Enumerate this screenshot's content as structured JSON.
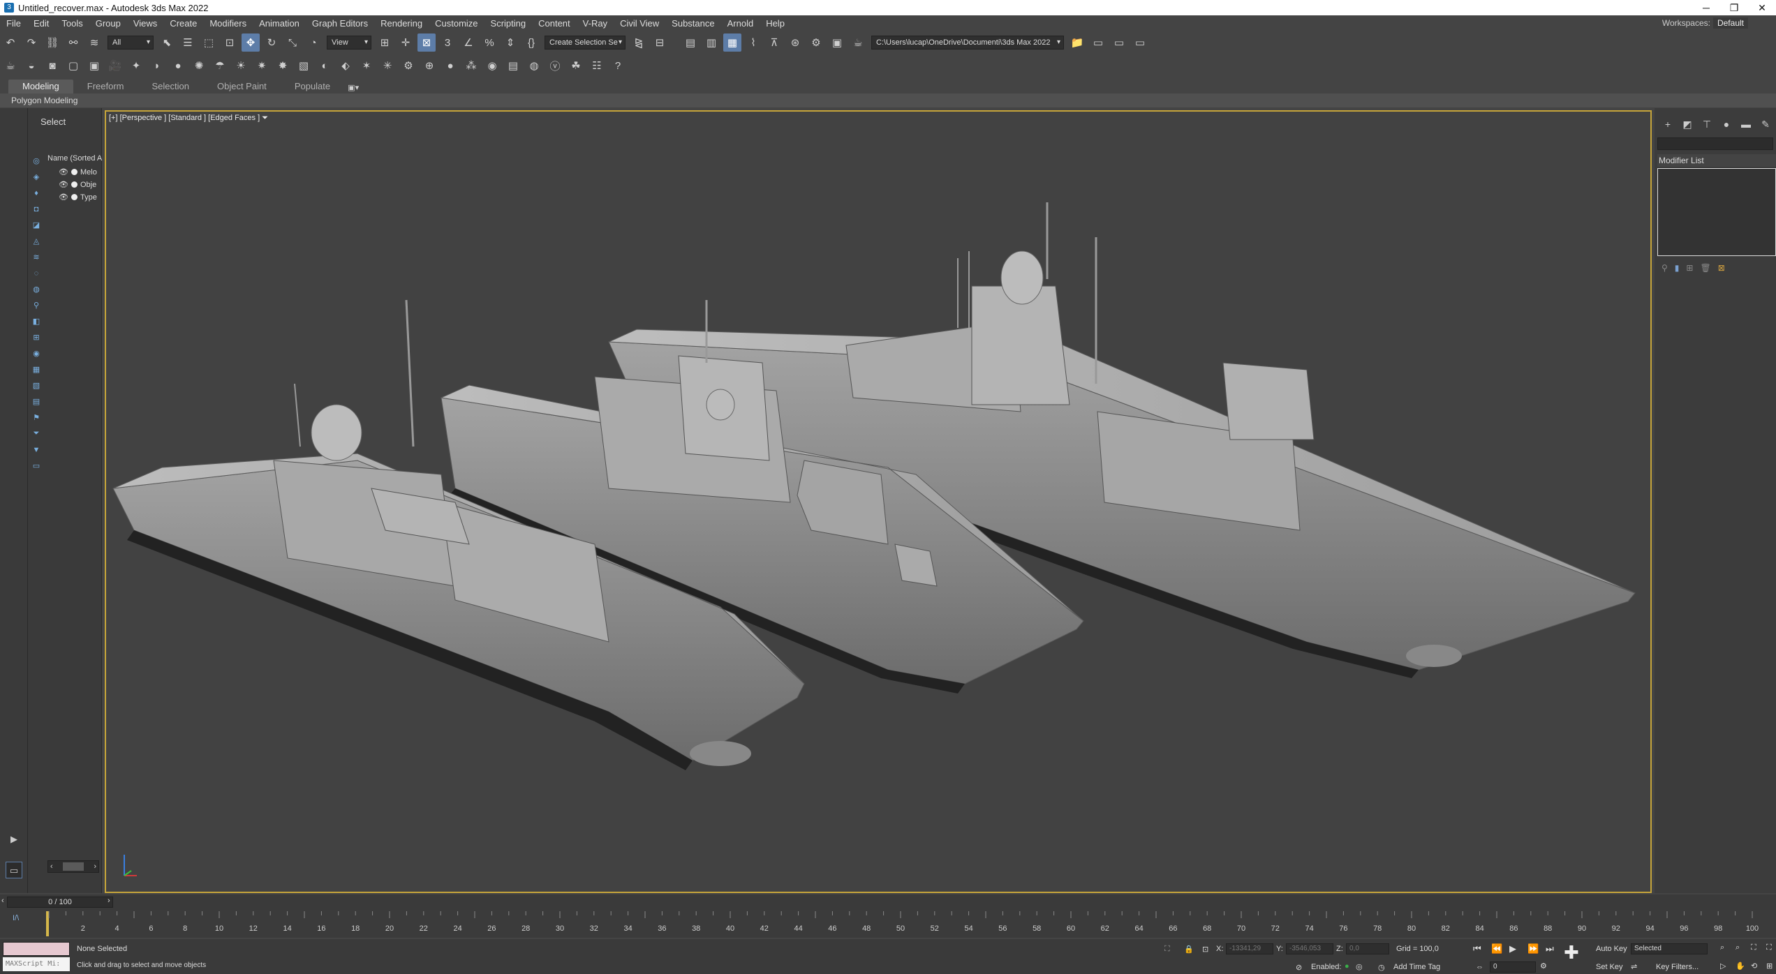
{
  "window": {
    "title": "Untitled_recover.max - Autodesk 3ds Max 2022",
    "app_icon": "3ds-max-icon"
  },
  "menu": {
    "items": [
      "File",
      "Edit",
      "Tools",
      "Group",
      "Views",
      "Create",
      "Modifiers",
      "Animation",
      "Graph Editors",
      "Rendering",
      "Customize",
      "Scripting",
      "Content",
      "V-Ray",
      "Civil View",
      "Substance",
      "Arnold",
      "Help"
    ],
    "workspace_label": "Workspaces:",
    "workspace_value": "Default"
  },
  "toolbar": {
    "filter_value": "All",
    "refcoord_value": "View",
    "selection_set": "Create Selection Se",
    "project_path": "C:\\Users\\lucap\\OneDrive\\Documenti\\3ds Max 2022"
  },
  "ribbon": {
    "tabs": [
      "Modeling",
      "Freeform",
      "Selection",
      "Object Paint",
      "Populate"
    ],
    "active_tab": "Modeling",
    "sub_label": "Polygon Modeling"
  },
  "scene_explorer": {
    "title": "Select",
    "column_header": "Name (Sorted A",
    "rows": [
      "Melo",
      "Obje",
      "Type"
    ]
  },
  "viewport": {
    "label": "[+] [Perspective ] [Standard ] [Edged Faces ]"
  },
  "command_panel": {
    "modifier_list_label": "Modifier List"
  },
  "timeline": {
    "frame_display": "0 / 100",
    "track_label": "I/\\",
    "tick_labels": [
      "2",
      "4",
      "6",
      "8",
      "10",
      "12",
      "14",
      "16",
      "18",
      "20",
      "22",
      "24",
      "26",
      "28",
      "30",
      "32",
      "34",
      "36",
      "38",
      "40",
      "42",
      "44",
      "46",
      "48",
      "50",
      "52",
      "54",
      "56",
      "58",
      "60",
      "62",
      "64",
      "66",
      "68",
      "70",
      "72",
      "74",
      "76",
      "78",
      "80",
      "82",
      "84",
      "86",
      "88",
      "90",
      "92",
      "94",
      "96",
      "98",
      "100"
    ]
  },
  "status": {
    "maxscript_placeholder": "MAXScript Mi:",
    "selection_msg": "None Selected",
    "prompt_msg": "Click and drag to select and move objects",
    "x_label": "X:",
    "x_value": "-13341,29",
    "y_label": "Y:",
    "y_value": "-3546,053",
    "z_label": "Z:",
    "z_value": "0,0",
    "grid_text": "Grid = 100,0",
    "enabled_label": "Enabled:",
    "add_time_tag": "Add Time Tag",
    "auto_key": "Auto Key",
    "selected_value": "Selected",
    "set_key": "Set Key",
    "key_filters": "Key Filters...",
    "current_frame": "0"
  },
  "colors": {
    "viewport_border": "#c6a53a",
    "active_btn": "#5d7da8",
    "bg": "#444444"
  }
}
